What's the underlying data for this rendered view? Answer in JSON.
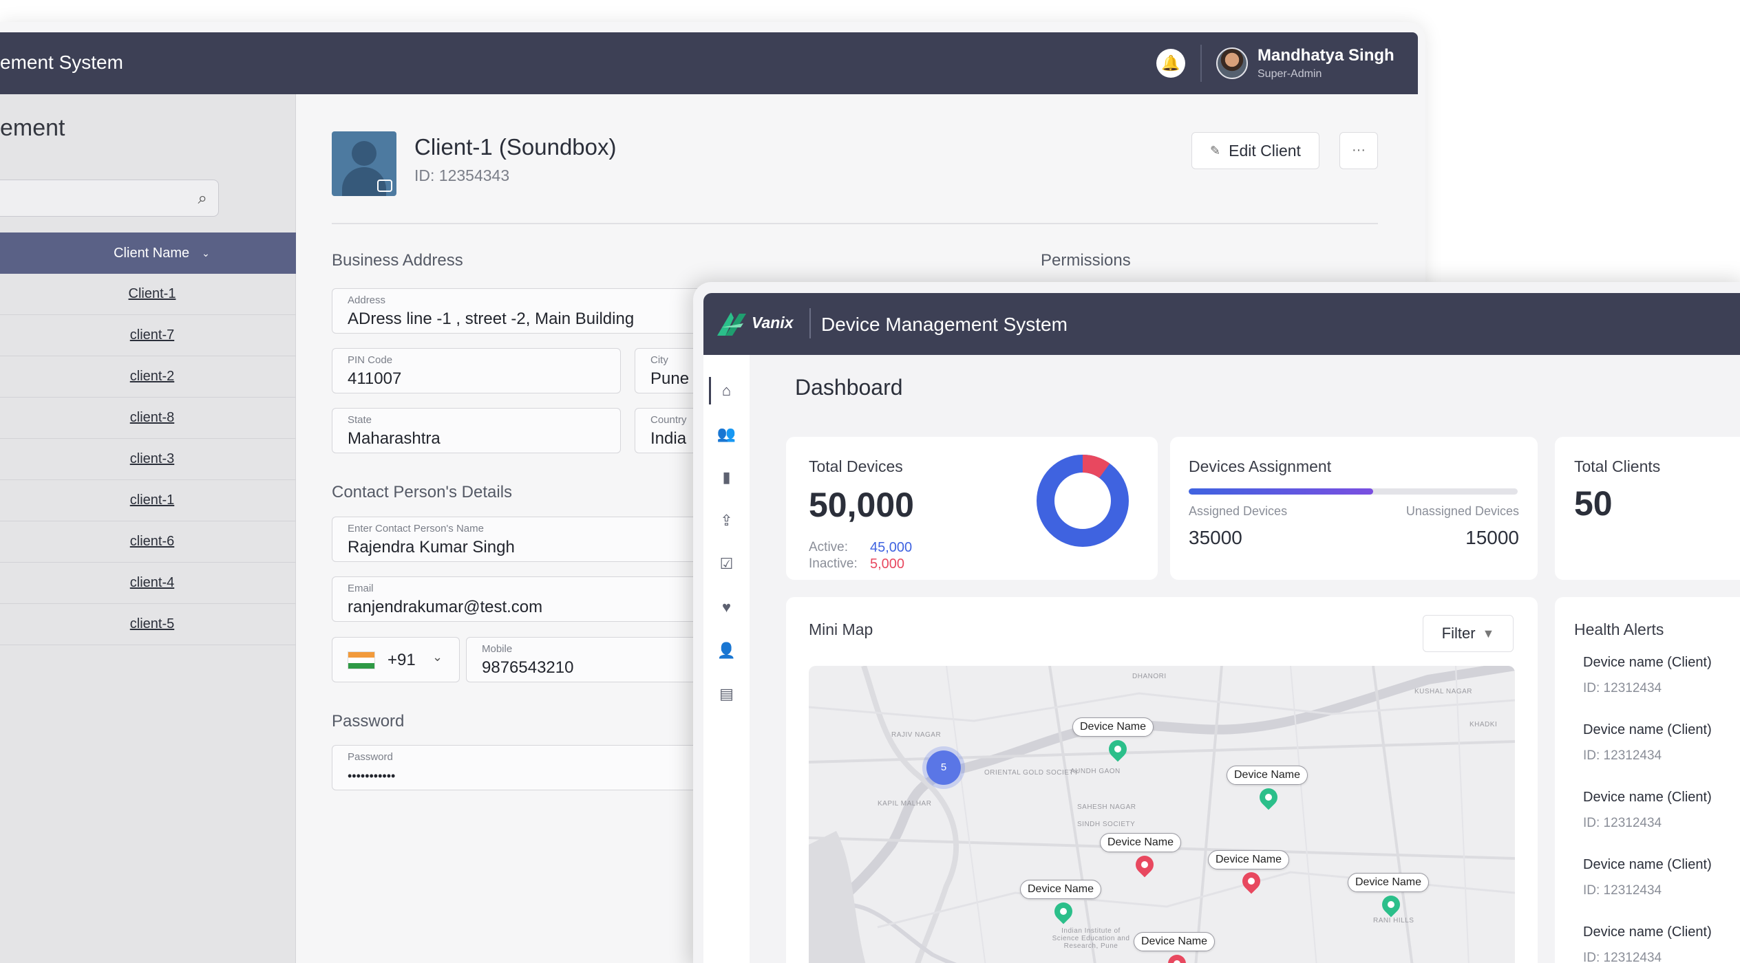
{
  "back_window": {
    "app_title": "ement System",
    "user": {
      "name": "Mandhatya Singh",
      "role": "Super-Admin"
    },
    "sidebar": {
      "heading": "ement",
      "column_header": "Client Name",
      "clients": [
        "Client-1",
        "client-7",
        "client-2",
        "client-8",
        "client-3",
        "client-1",
        "client-6",
        "client-4",
        "client-5"
      ]
    },
    "client": {
      "name": "Client-1 (Soundbox)",
      "id": "ID: 12354343",
      "edit_label": "Edit Client",
      "more_label": "···"
    },
    "business_address": {
      "section": "Business Address",
      "address_label": "Address",
      "address": "ADress line -1 , street -2, Main Building",
      "pin_label": "PIN Code",
      "pin": "411007",
      "city_label": "City",
      "city": "Pune",
      "state_label": "State",
      "state": "Maharashtra",
      "country_label": "Country",
      "country": "India"
    },
    "permissions": {
      "section": "Permissions"
    },
    "contact": {
      "section": "Contact Person's Details",
      "name_label": "Enter Contact Person's Name",
      "name": "Rajendra Kumar Singh",
      "email_label": "Email",
      "email": "ranjendrakumar@test.com",
      "country_code": "+91",
      "mobile_label": "Mobile",
      "mobile": "9876543210"
    },
    "password": {
      "section": "Password",
      "label": "Password",
      "value": "•••••••••••"
    }
  },
  "front_window": {
    "logo": "Vanix",
    "app_title": "Device Management System",
    "page_title": "Dashboard",
    "total_devices": {
      "title": "Total Devices",
      "value": "50,000",
      "active_label": "Active:",
      "active_value": "45,000",
      "inactive_label": "Inactive:",
      "inactive_value": "5,000",
      "active_fraction": 0.9,
      "active_color": "#3f63e0",
      "inactive_color": "#e8485f"
    },
    "assignment": {
      "title": "Devices Assignment",
      "assigned_label": "Assigned Devices",
      "assigned_value": "35000",
      "unassigned_label": "Unassigned Devices",
      "unassigned_value": "15000",
      "assigned_fraction": 0.56
    },
    "total_clients": {
      "title": "Total Clients",
      "value": "50"
    },
    "mini_map": {
      "title": "Mini Map",
      "filter_label": "Filter",
      "cluster_count": "5",
      "pins": [
        {
          "label": "Device Name",
          "status": "green"
        },
        {
          "label": "Device Name",
          "status": "green"
        },
        {
          "label": "Device Name",
          "status": "red"
        },
        {
          "label": "Device Name",
          "status": "red"
        },
        {
          "label": "Device Name",
          "status": "green"
        },
        {
          "label": "Device Name",
          "status": "green"
        },
        {
          "label": "Device Name",
          "status": "red"
        }
      ],
      "places": [
        "RAJIV NAGAR",
        "KAPIL MALHAR",
        "DHANORI",
        "ORIENTAL GOLD SOCIETY",
        "SAHESH NAGAR",
        "SINDH SOCIETY",
        "AUNDH GAON",
        "KHADKI",
        "KUSHAL NAGAR",
        "RANI HILLS",
        "Indian Institute of Science Education and Research, Pune"
      ]
    },
    "health_alerts": {
      "title": "Health Alerts",
      "items": [
        {
          "name": "Device name (Client)",
          "id": "ID: 12312434"
        },
        {
          "name": "Device name (Client)",
          "id": "ID: 12312434"
        },
        {
          "name": "Device name (Client)",
          "id": "ID: 12312434"
        },
        {
          "name": "Device name (Client)",
          "id": "ID: 12312434"
        },
        {
          "name": "Device name (Client)",
          "id": "ID: 12312434"
        }
      ]
    },
    "colors": {
      "header": "#3d4055",
      "green_pin": "#2bbf8a",
      "red_pin": "#e8485f",
      "accent": "#3f63e0"
    },
    "rail_icons": [
      "home-icon",
      "users-icon",
      "device-icon",
      "upload-icon",
      "clipboard-icon",
      "heart-icon",
      "user-icon",
      "document-icon"
    ]
  }
}
